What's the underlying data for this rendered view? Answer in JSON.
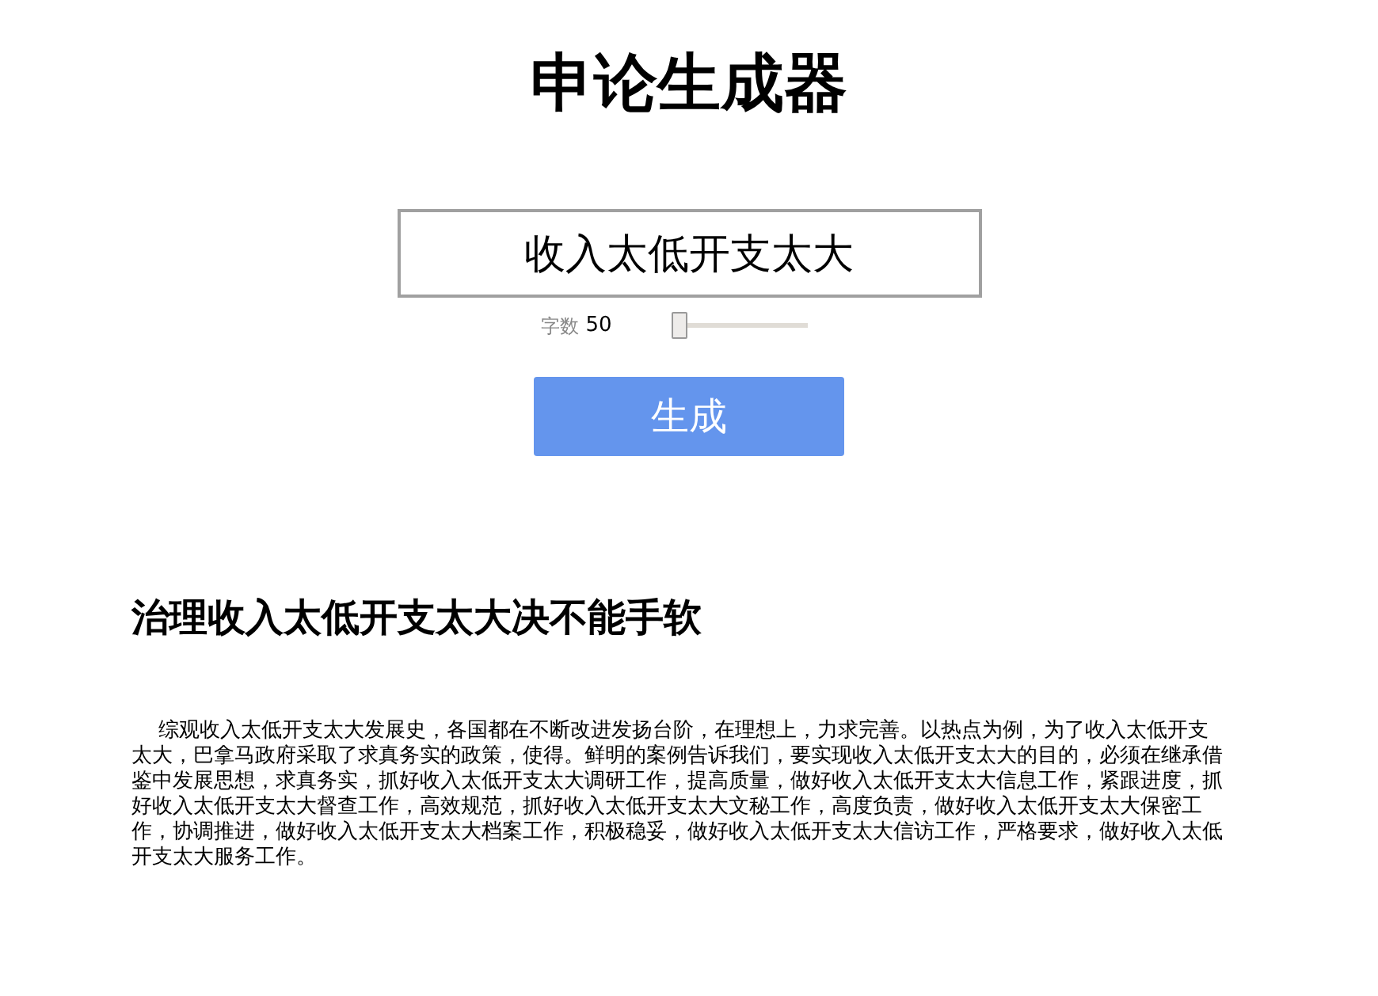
{
  "title": "申论生成器",
  "topic_input": {
    "value": "收入太低开支太大"
  },
  "word_count": {
    "label": "字数",
    "value": "50",
    "level": 0
  },
  "generate_button": "生成",
  "article": {
    "heading": "治理收入太低开支太大决不能手软",
    "body": "综观收入太低开支太大发展史，各国都在不断改进发扬台阶，在理想上，力求完善。以热点为例，为了收入太低开支太大，巴拿马政府采取了求真务实的政策，使得。鲜明的案例告诉我们，要实现收入太低开支太大的目的，必须在继承借鉴中发展思想，求真务实，抓好收入太低开支太大调研工作，提高质量，做好收入太低开支太大信息工作，紧跟进度，抓好收入太低开支太大督查工作，高效规范，抓好收入太低开支太大文秘工作，高度负责，做好收入太低开支太大保密工作，协调推进，做好收入太低开支太大档案工作，积极稳妥，做好收入太低开支太大信访工作，严格要求，做好收入太低开支太大服务工作。"
  }
}
